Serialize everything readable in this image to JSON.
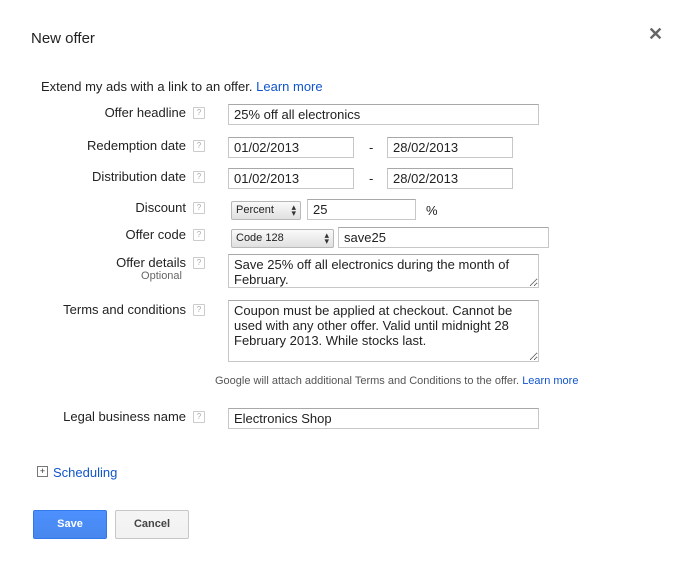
{
  "dialog": {
    "title": "New offer",
    "close_glyph": "✕"
  },
  "intro": {
    "text": "Extend my ads with a link to an offer.",
    "link": "Learn more"
  },
  "help_glyph": "?",
  "fields": {
    "headline": {
      "label": "Offer headline",
      "value": "25% off all electronics"
    },
    "redemption": {
      "label": "Redemption date",
      "start": "01/02/2013",
      "end": "28/02/2013",
      "separator": "-"
    },
    "distribution": {
      "label": "Distribution date",
      "start": "01/02/2013",
      "end": "28/02/2013",
      "separator": "-"
    },
    "discount": {
      "label": "Discount",
      "type": "Percent",
      "value": "25",
      "unit": "%"
    },
    "code": {
      "label": "Offer code",
      "type": "Code 128",
      "value": "save25"
    },
    "details": {
      "label": "Offer details",
      "sublabel": "Optional",
      "value": "Save 25% off all electronics during the month of February."
    },
    "terms": {
      "label": "Terms and conditions",
      "value": "Coupon must be applied at checkout. Cannot be used with any other offer. Valid until midnight 28 February 2013. While stocks last."
    },
    "terms_note": {
      "text": "Google will attach additional Terms and Conditions to the offer.",
      "link": "Learn more"
    },
    "business": {
      "label": "Legal business name",
      "value": "Electronics Shop"
    }
  },
  "scheduling": {
    "expand_glyph": "+",
    "label": "Scheduling"
  },
  "buttons": {
    "save": "Save",
    "cancel": "Cancel"
  }
}
